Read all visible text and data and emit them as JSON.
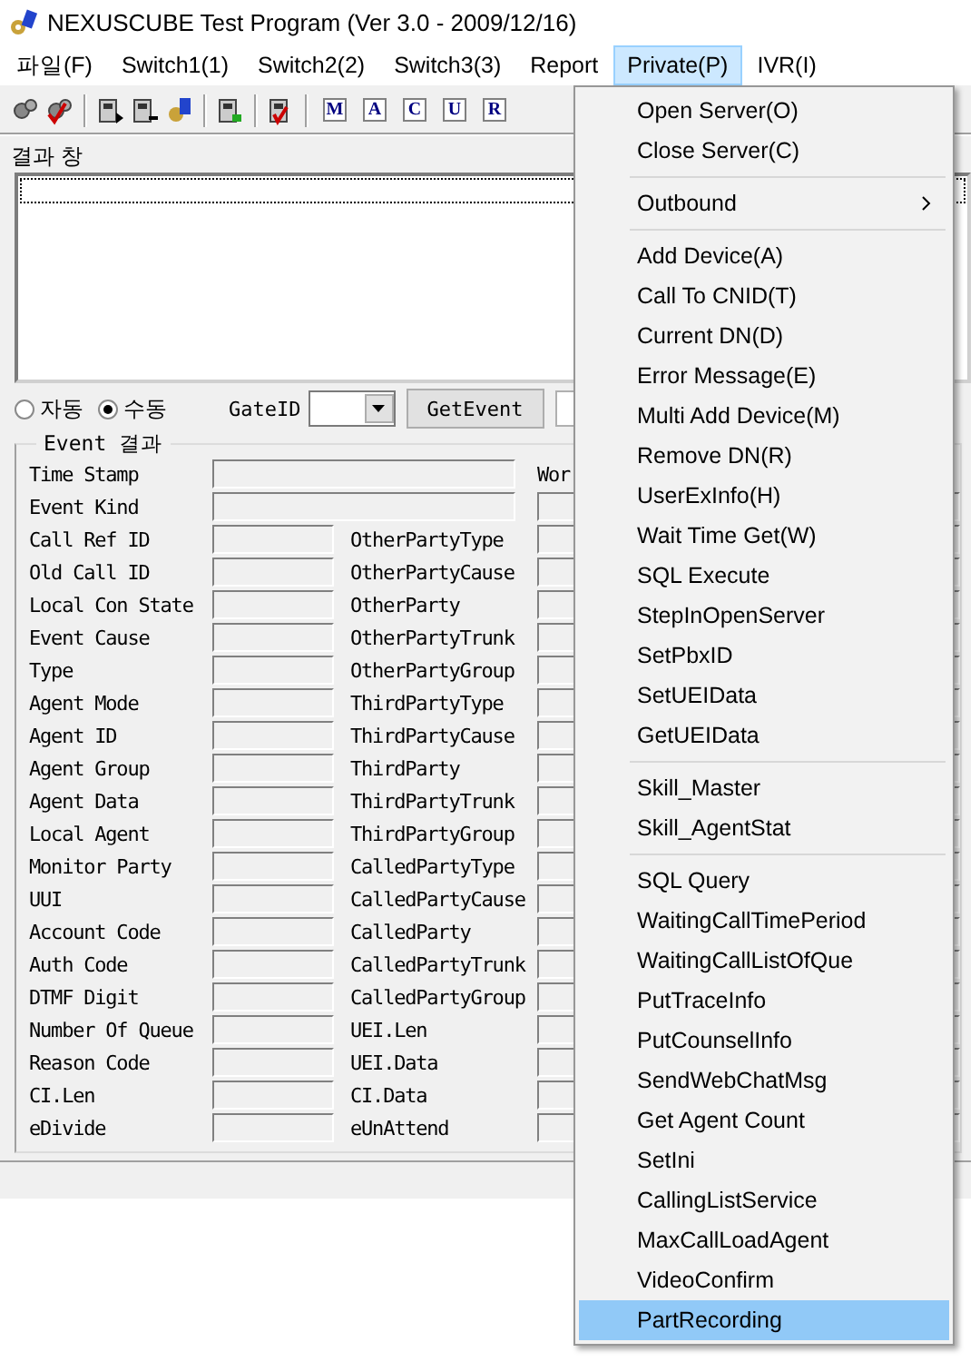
{
  "window": {
    "title": "NEXUSCUBE Test Program (Ver 3.0 - 2009/12/16)"
  },
  "menubar": [
    {
      "label": "파일(F)",
      "selected": false
    },
    {
      "label": "Switch1(1)",
      "selected": false
    },
    {
      "label": "Switch2(2)",
      "selected": false
    },
    {
      "label": "Switch3(3)",
      "selected": false
    },
    {
      "label": "Report",
      "selected": false
    },
    {
      "label": "Private(P)",
      "selected": true
    },
    {
      "label": "IVR(I)",
      "selected": false
    }
  ],
  "toolbar": {
    "letter_buttons": [
      "M",
      "A",
      "C",
      "U",
      "R"
    ]
  },
  "result_window": {
    "label": "결과 창"
  },
  "mode": {
    "radios": [
      {
        "label": "자동",
        "checked": false
      },
      {
        "label": "수동",
        "checked": true
      }
    ],
    "gate_label": "GateID",
    "get_event_button": "GetEvent"
  },
  "event_group": {
    "title": "Event 결과",
    "rows": [
      {
        "kind": "wide",
        "label": "Time Stamp",
        "side_label": "Wor"
      },
      {
        "kind": "wide",
        "label": "Event Kind"
      },
      {
        "kind": "pair",
        "label": "Call Ref ID",
        "label_2": "OtherPartyType"
      },
      {
        "kind": "pair",
        "label": "Old Call ID",
        "label_2": "OtherPartyCause"
      },
      {
        "kind": "pair",
        "label": "Local Con State",
        "label_2": "OtherParty"
      },
      {
        "kind": "pair",
        "label": "Event Cause",
        "label_2": "OtherPartyTrunk"
      },
      {
        "kind": "pair",
        "label": "Type",
        "label_2": "OtherPartyGroup"
      },
      {
        "kind": "pair",
        "label": "Agent Mode",
        "label_2": "ThirdPartyType"
      },
      {
        "kind": "pair",
        "label": "Agent ID",
        "label_2": "ThirdPartyCause"
      },
      {
        "kind": "pair",
        "label": "Agent Group",
        "label_2": "ThirdParty"
      },
      {
        "kind": "pair",
        "label": "Agent Data",
        "label_2": "ThirdPartyTrunk"
      },
      {
        "kind": "pair",
        "label": "Local Agent",
        "label_2": "ThirdPartyGroup"
      },
      {
        "kind": "pair",
        "label": "Monitor Party",
        "label_2": "CalledPartyType"
      },
      {
        "kind": "pair",
        "label": "UUI",
        "label_2": "CalledPartyCause"
      },
      {
        "kind": "pair",
        "label": "Account Code",
        "label_2": "CalledParty"
      },
      {
        "kind": "pair",
        "label": "Auth Code",
        "label_2": "CalledPartyTrunk"
      },
      {
        "kind": "pair",
        "label": "DTMF Digit",
        "label_2": "CalledPartyGroup"
      },
      {
        "kind": "pair",
        "label": "Number Of Queue",
        "label_2": "UEI.Len"
      },
      {
        "kind": "pair",
        "label": "Reason Code",
        "label_2": "UEI.Data"
      },
      {
        "kind": "pair",
        "label": "CI.Len",
        "label_2": "CI.Data"
      },
      {
        "kind": "pair",
        "label": "eDivide",
        "label_2": "eUnAttend"
      }
    ]
  },
  "private_menu": {
    "sections": [
      {
        "items": [
          {
            "kind": "item",
            "label": "Open Server(O)",
            "selected": false
          },
          {
            "kind": "item",
            "label": "Close Server(C)",
            "selected": false
          }
        ]
      },
      {
        "items": [
          {
            "kind": "submenu",
            "label": "Outbound",
            "selected": false
          }
        ]
      },
      {
        "items": [
          {
            "kind": "item",
            "label": "Add Device(A)",
            "selected": false
          },
          {
            "kind": "item",
            "label": "Call To CNID(T)",
            "selected": false
          },
          {
            "kind": "item",
            "label": "Current DN(D)",
            "selected": false
          },
          {
            "kind": "item",
            "label": "Error Message(E)",
            "selected": false
          },
          {
            "kind": "item",
            "label": "Multi Add Device(M)",
            "selected": false
          },
          {
            "kind": "item",
            "label": "Remove DN(R)",
            "selected": false
          },
          {
            "kind": "item",
            "label": "UserExInfo(H)",
            "selected": false
          },
          {
            "kind": "item",
            "label": "Wait Time Get(W)",
            "selected": false
          },
          {
            "kind": "item",
            "label": "SQL Execute",
            "selected": false
          },
          {
            "kind": "item",
            "label": "StepInOpenServer",
            "selected": false
          },
          {
            "kind": "item",
            "label": "SetPbxID",
            "selected": false
          },
          {
            "kind": "item",
            "label": "SetUEIData",
            "selected": false
          },
          {
            "kind": "item",
            "label": "GetUEIData",
            "selected": false
          }
        ]
      },
      {
        "items": [
          {
            "kind": "item",
            "label": "Skill_Master",
            "selected": false
          },
          {
            "kind": "item",
            "label": "Skill_AgentStat",
            "selected": false
          }
        ]
      },
      {
        "items": [
          {
            "kind": "item",
            "label": "SQL Query",
            "selected": false
          },
          {
            "kind": "item",
            "label": "WaitingCallTimePeriod",
            "selected": false
          },
          {
            "kind": "item",
            "label": "WaitingCallListOfQue",
            "selected": false
          },
          {
            "kind": "item",
            "label": "PutTraceInfo",
            "selected": false
          },
          {
            "kind": "item",
            "label": "PutCounselInfo",
            "selected": false
          },
          {
            "kind": "item",
            "label": "SendWebChatMsg",
            "selected": false
          },
          {
            "kind": "item",
            "label": "Get Agent Count",
            "selected": false
          },
          {
            "kind": "item",
            "label": "SetIni",
            "selected": false
          },
          {
            "kind": "item",
            "label": "CallingListService",
            "selected": false
          },
          {
            "kind": "item",
            "label": "MaxCallLoadAgent",
            "selected": false
          },
          {
            "kind": "item",
            "label": "VideoConfirm",
            "selected": false
          },
          {
            "kind": "item",
            "label": "PartRecording",
            "selected": true
          }
        ]
      }
    ]
  }
}
